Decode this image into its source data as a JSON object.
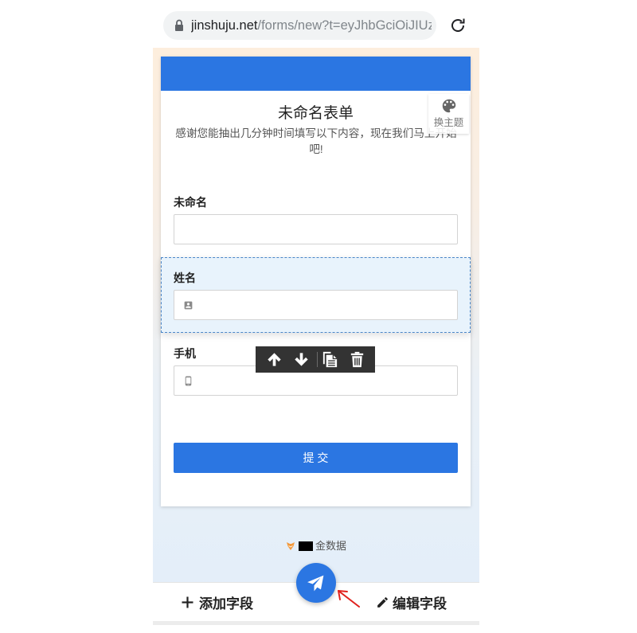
{
  "browser": {
    "url_host": "jinshuju.net",
    "url_path": "/forms/new?t=eyJhbGciOiJIUzI",
    "lock_icon": "lock-icon",
    "reload_icon": "reload-icon"
  },
  "theme_button": {
    "label": "换主题",
    "icon": "palette-icon"
  },
  "form": {
    "title": "未命名表单",
    "description": "感谢您能抽出几分钟时间填写以下内容，现在我们马上开始吧!",
    "fields": [
      {
        "label": "未命名",
        "value": "",
        "selected": false
      },
      {
        "label": "姓名",
        "value": "",
        "icon": "contact-card-icon",
        "selected": true
      },
      {
        "label": "手机",
        "value": "",
        "icon": "phone-icon",
        "selected": false
      }
    ],
    "submit_label": "提 交"
  },
  "field_toolbar": {
    "buttons": [
      "arrow-up-icon",
      "arrow-down-icon",
      "copy-icon",
      "trash-icon"
    ]
  },
  "footer": {
    "brand": "金数据",
    "logo_icon": "jinshuju-logo-icon"
  },
  "bottom_bar": {
    "add_field_label": "添加字段",
    "add_field_icon": "plus-icon",
    "edit_field_label": "编辑字段",
    "edit_field_icon": "pencil-icon",
    "publish_icon": "paper-plane-icon"
  },
  "colors": {
    "primary": "#2b76e2",
    "toolbar_bg": "#333333",
    "selected_field_bg": "#e8f3fc",
    "annotation_arrow": "#e0211d",
    "background_top": "#fdeedd",
    "background_bottom": "#e2eefa"
  }
}
